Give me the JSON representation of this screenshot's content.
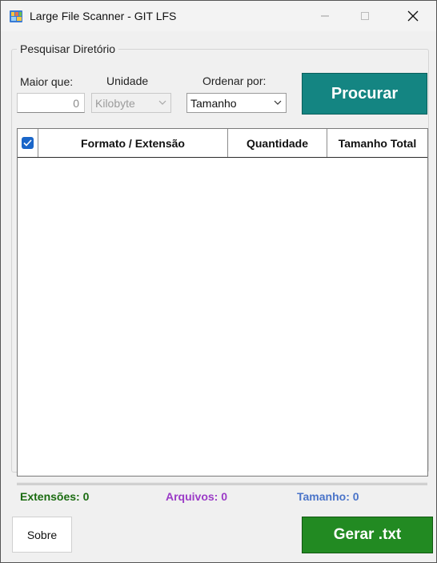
{
  "window": {
    "title": "Large File Scanner - GIT LFS",
    "icon": "app-icon"
  },
  "search": {
    "group_title": "Pesquisar Diretório",
    "min_size_label": "Maior que:",
    "min_size_value": "0",
    "unit_label": "Unidade",
    "unit_value": "Kilobyte",
    "sort_label": "Ordenar por:",
    "sort_value": "Tamanho",
    "search_button": "Procurar"
  },
  "table": {
    "header_checked": true,
    "columns": [
      "Formato / Extensão",
      "Quantidade",
      "Tamanho Total"
    ],
    "rows": []
  },
  "stats": {
    "extensions": "Extensões: 0",
    "files": "Arquivos: 0",
    "size": "Tamanho: 0"
  },
  "footer": {
    "about_button": "Sobre",
    "generate_button": "Gerar .txt"
  },
  "colors": {
    "search_button": "#148582",
    "generate_button": "#228a22",
    "extensions_text": "#1a6b10",
    "files_text": "#9b3bc7",
    "size_text": "#4a74c9",
    "checkbox": "#1a66c9"
  }
}
